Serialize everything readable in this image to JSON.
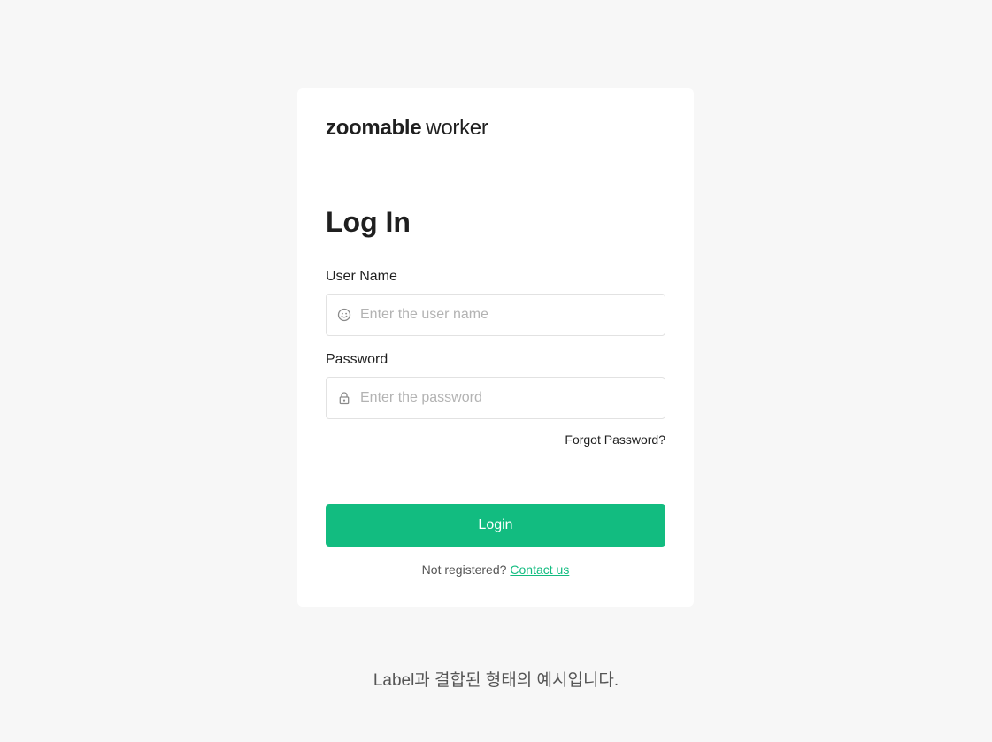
{
  "logo": {
    "bold": "zoomable",
    "light": "worker"
  },
  "form": {
    "title": "Log In",
    "username": {
      "label": "User Name",
      "placeholder": "Enter the user name",
      "value": "",
      "icon": "smiley-icon"
    },
    "password": {
      "label": "Password",
      "placeholder": "Enter the password",
      "value": "",
      "icon": "lock-icon"
    },
    "forgot_label": "Forgot Password?",
    "login_label": "Login",
    "register_prompt": "Not registered?",
    "contact_label": "Contact us"
  },
  "caption": "Label과 결합된 형태의 예시입니다.",
  "colors": {
    "accent": "#12bc80",
    "background": "#f7f7f7",
    "card": "#ffffff"
  }
}
